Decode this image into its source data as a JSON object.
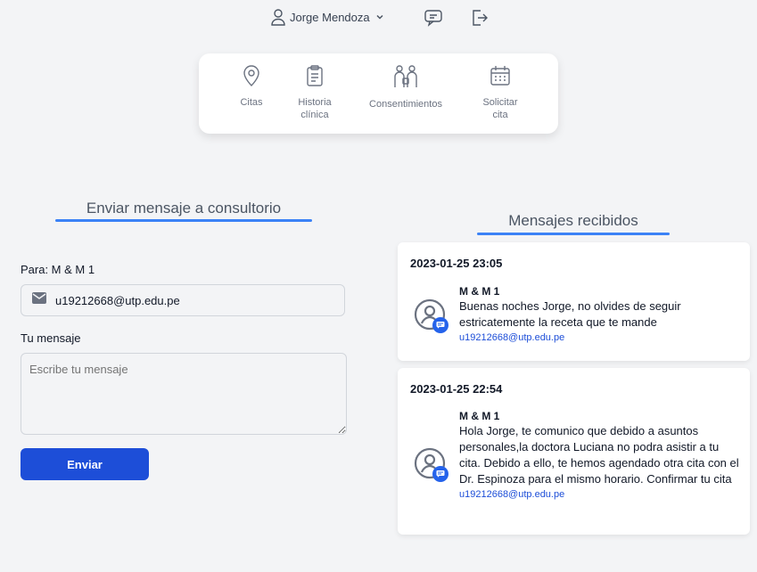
{
  "header": {
    "user_name": "Jorge Mendoza"
  },
  "nav": {
    "items": [
      {
        "label": "Citas",
        "icon": "map-pin-icon"
      },
      {
        "label": "Historia\nclínica",
        "icon": "clipboard-icon"
      },
      {
        "label": "Consentimientos",
        "icon": "people-icon"
      },
      {
        "label": "Solicitar\ncita",
        "icon": "calendar-icon"
      }
    ]
  },
  "send_form": {
    "title": "Enviar mensaje a consultorio",
    "to_label": "Para: M & M 1",
    "email_value": "u19212668@utp.edu.pe",
    "message_label": "Tu mensaje",
    "message_placeholder": "Escribe tu mensaje",
    "send_label": "Enviar"
  },
  "inbox": {
    "title": "Mensajes recibidos",
    "messages": [
      {
        "date": "2023-01-25 23:05",
        "sender": "M & M 1",
        "text": "Buenas noches Jorge, no olvides de seguir estricatemente la receta que te mande",
        "email": "u19212668@utp.edu.pe"
      },
      {
        "date": "2023-01-25 22:54",
        "sender": "M & M 1",
        "text": "Hola Jorge, te comunico que debido a asuntos personales,la doctora Luciana no podra asistir a tu cita. Debido a ello, te hemos agendado otra cita con el Dr. Espinoza para el mismo horario. Confirmar tu cita",
        "email": "u19212668@utp.edu.pe"
      }
    ]
  },
  "colors": {
    "accent": "#3b82f6",
    "button": "#1d4ed8",
    "background": "#f3f4f6"
  }
}
